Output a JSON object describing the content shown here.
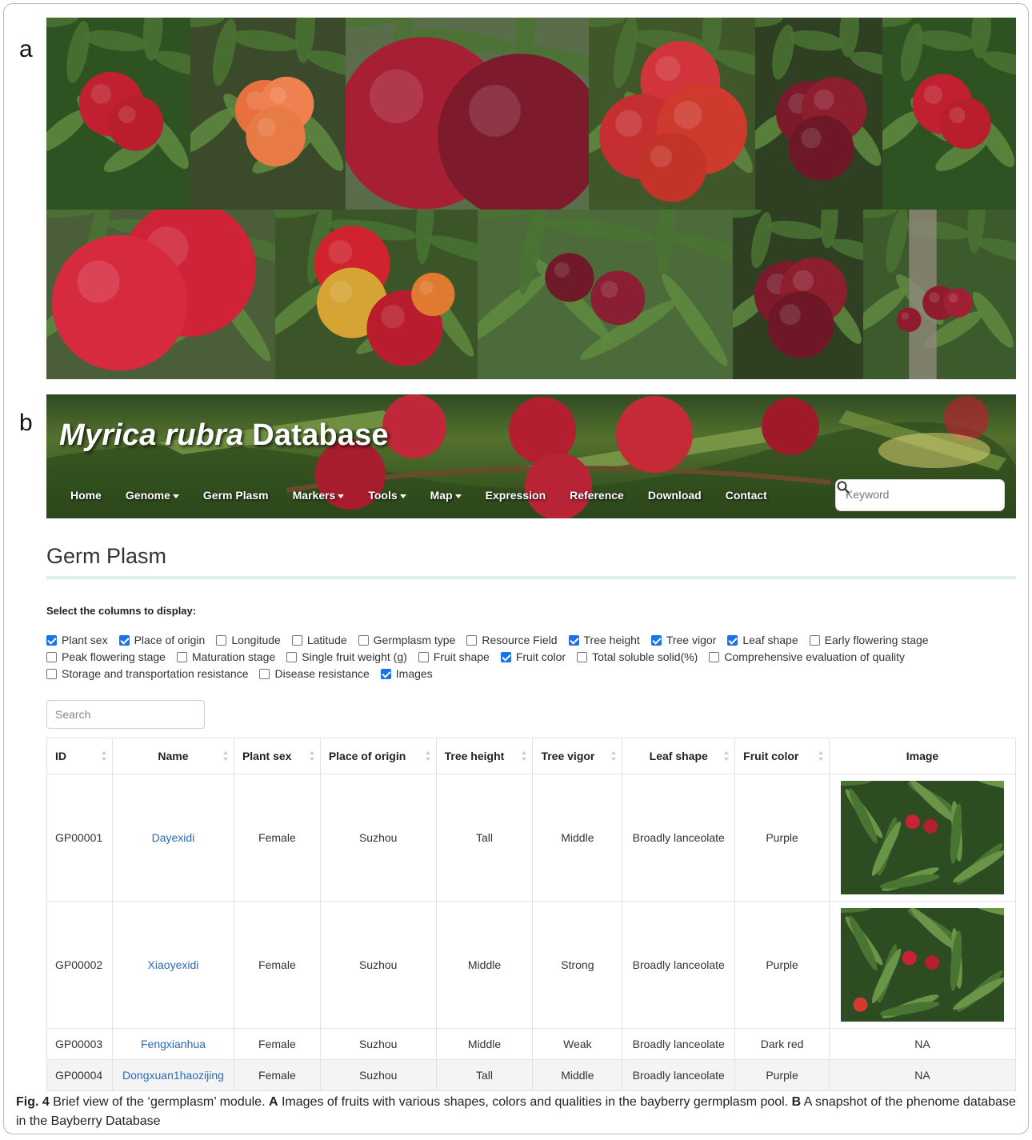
{
  "panel_labels": {
    "a": "a",
    "b": "b"
  },
  "photos": [
    {
      "name": "photo-1",
      "scheme": "leafy-two-red"
    },
    {
      "name": "photo-2",
      "scheme": "orange-cluster"
    },
    {
      "name": "photo-3",
      "scheme": "closeup-two"
    },
    {
      "name": "photo-4",
      "scheme": "cluster-red"
    },
    {
      "name": "photo-5",
      "scheme": "dark-cluster"
    },
    {
      "name": "photo-6",
      "scheme": "leafy-two-red"
    },
    {
      "name": "photo-7",
      "scheme": "closeup-two-bright"
    },
    {
      "name": "photo-8",
      "scheme": "mixed-ripeness"
    },
    {
      "name": "photo-9",
      "scheme": "purple-pair"
    },
    {
      "name": "photo-10",
      "scheme": "dark-cluster"
    },
    {
      "name": "photo-11",
      "scheme": "tree-trunk"
    }
  ],
  "site": {
    "title_italic": "Myrica rubra",
    "title_rest": " Database",
    "nav": [
      {
        "label": "Home",
        "dropdown": false
      },
      {
        "label": "Genome",
        "dropdown": true
      },
      {
        "label": "Germ Plasm",
        "dropdown": false
      },
      {
        "label": "Markers",
        "dropdown": true
      },
      {
        "label": "Tools",
        "dropdown": true
      },
      {
        "label": "Map",
        "dropdown": true
      },
      {
        "label": "Expression",
        "dropdown": false
      },
      {
        "label": "Reference",
        "dropdown": false
      },
      {
        "label": "Download",
        "dropdown": false
      },
      {
        "label": "Contact",
        "dropdown": false
      }
    ],
    "keyword_placeholder": "Keyword"
  },
  "page": {
    "title": "Germ Plasm",
    "columns_heading": "Select the columns to display:",
    "column_options": [
      [
        {
          "label": "Plant sex",
          "checked": true
        },
        {
          "label": "Place of origin",
          "checked": true
        },
        {
          "label": "Longitude",
          "checked": false
        },
        {
          "label": "Latitude",
          "checked": false
        },
        {
          "label": "Germplasm type",
          "checked": false
        },
        {
          "label": "Resource Field",
          "checked": false
        },
        {
          "label": "Tree height",
          "checked": true
        },
        {
          "label": "Tree vigor",
          "checked": true
        },
        {
          "label": "Leaf shape",
          "checked": true
        },
        {
          "label": "Early flowering stage",
          "checked": false
        }
      ],
      [
        {
          "label": "Peak flowering stage",
          "checked": false
        },
        {
          "label": "Maturation stage",
          "checked": false
        },
        {
          "label": "Single fruit weight (g)",
          "checked": false
        },
        {
          "label": "Fruit shape",
          "checked": false
        },
        {
          "label": "Fruit color",
          "checked": true
        },
        {
          "label": "Total soluble solid(%)",
          "checked": false
        },
        {
          "label": "Comprehensive evaluation of quality",
          "checked": false
        }
      ],
      [
        {
          "label": "Storage and transportation resistance",
          "checked": false
        },
        {
          "label": "Disease resistance",
          "checked": false
        },
        {
          "label": "Images",
          "checked": true
        }
      ]
    ],
    "search_placeholder": "Search",
    "table": {
      "headers": [
        "ID",
        "Name",
        "Plant sex",
        "Place of origin",
        "Tree height",
        "Tree vigor",
        "Leaf shape",
        "Fruit color",
        "Image"
      ],
      "rows": [
        {
          "id": "GP00001",
          "name": "Dayexidi",
          "sex": "Female",
          "origin": "Suzhou",
          "height": "Tall",
          "vigor": "Middle",
          "leaf": "Broadly lanceolate",
          "color": "Purple",
          "image": null
        },
        {
          "id": "GP00002",
          "name": "Xiaoyexidi",
          "sex": "Female",
          "origin": "Suzhou",
          "height": "Middle",
          "vigor": "Strong",
          "leaf": "Broadly lanceolate",
          "color": "Purple",
          "image": null
        },
        {
          "id": "GP00003",
          "name": "Fengxianhua",
          "sex": "Female",
          "origin": "Suzhou",
          "height": "Middle",
          "vigor": "Weak",
          "leaf": "Broadly lanceolate",
          "color": "Dark red",
          "image": "NA"
        },
        {
          "id": "GP00004",
          "name": "Dongxuan1haozijing",
          "sex": "Female",
          "origin": "Suzhou",
          "height": "Tall",
          "vigor": "Middle",
          "leaf": "Broadly lanceolate",
          "color": "Purple",
          "image": "NA"
        }
      ]
    }
  },
  "caption": {
    "fig": "Fig. 4",
    "text1": "  Brief view of the ‘germplasm’ module. ",
    "a_label": "A",
    "text2": " Images of fruits with various shapes, colors and qualities in the bayberry germplasm pool. ",
    "b_label": "B",
    "text3": " A snapshot of the phenome database in the Bayberry Database"
  },
  "colors": {
    "link": "#2a6ab6",
    "checkbox": "#1a73e8",
    "rule": "#dcefe9",
    "fruit_red": "#c8213a",
    "fruit_dark": "#6d1a2a",
    "leaf": "#3f6b2c"
  }
}
